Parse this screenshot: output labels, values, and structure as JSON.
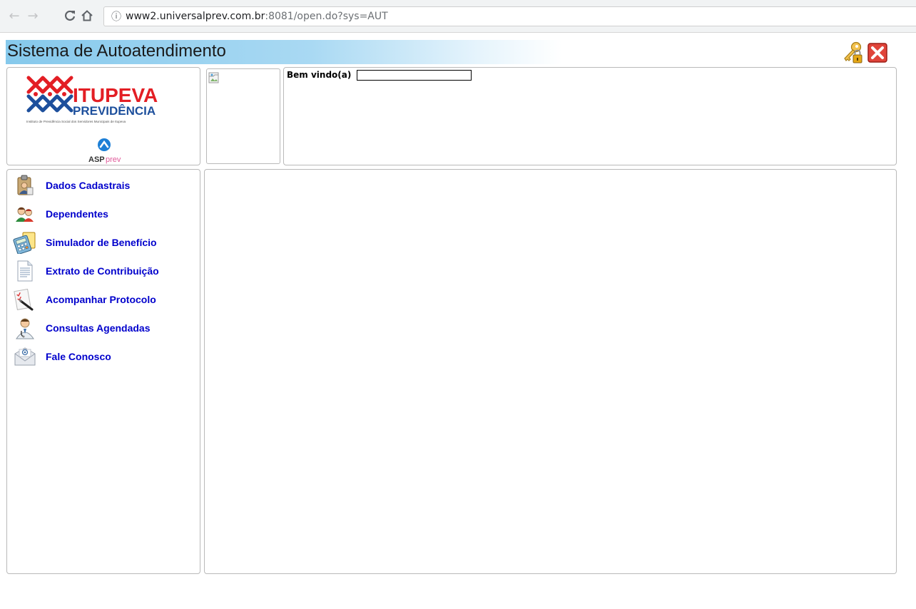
{
  "browser": {
    "back_glyph": "←",
    "forward_glyph": "→",
    "reload_glyph": "C",
    "home_glyph": "⌂",
    "info_glyph": "ⓘ",
    "url_host": "www2.universalprev.com.br",
    "url_rest": ":8081/open.do?sys=AUT"
  },
  "header": {
    "title": "Sistema de Autoatendimento",
    "accent_color": "#86c9ec"
  },
  "logo": {
    "brand_line1": "ITUPEVA",
    "brand_line2": "PREVIDÊNCIA",
    "brand_subtitle": "Instituto de Previdência Social dos Servidores Municipais de Itupeva",
    "partner_prefix": "ASP",
    "partner_suffix": "prev",
    "brand_color": "#e31e24",
    "brand_color2": "#1d4f9c"
  },
  "welcome": {
    "label": "Bem vindo(a)",
    "name_value": ""
  },
  "menu": {
    "link_color": "#0000cc",
    "items": [
      {
        "label": "Dados Cadastrais",
        "icon": "clipboard-person-icon"
      },
      {
        "label": "Dependentes",
        "icon": "people-icon"
      },
      {
        "label": "Simulador de Benefício",
        "icon": "calculator-icon"
      },
      {
        "label": "Extrato de Contribuição",
        "icon": "document-icon"
      },
      {
        "label": "Acompanhar Protocolo",
        "icon": "checklist-pen-icon"
      },
      {
        "label": "Consultas Agendadas",
        "icon": "doctor-icon"
      },
      {
        "label": "Fale Conosco",
        "icon": "email-envelope-icon"
      }
    ]
  }
}
